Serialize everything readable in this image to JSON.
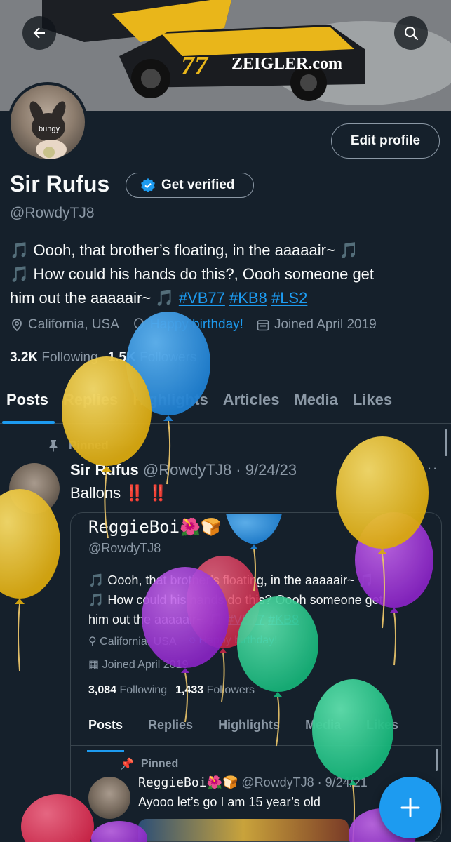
{
  "banner": {
    "car_number": "77",
    "car_text": "ZEIGLER.com"
  },
  "nav": {
    "back_icon": "arrow-left-icon",
    "search_icon": "search-icon"
  },
  "profile": {
    "avatar_text": "bungy",
    "edit_label": "Edit profile",
    "name": "Sir Rufus",
    "verified_label": "Get verified",
    "handle": "@RowdyTJ8",
    "bio_line1": "🎵 Oooh, that brother’s floating, in the aaaaair~ 🎵",
    "bio_line2": "🎵 How could his hands do this?, Oooh someone get",
    "bio_line3": "him out the aaaaair~ 🎵 ",
    "hashtags": [
      "#VB77",
      "#KB8",
      "#LS2"
    ],
    "location": "California, USA",
    "birthday": "Happy birthday!",
    "joined": "Joined April 2019",
    "following_count": "3.2K",
    "following_label": "Following",
    "followers_count": "1.5K",
    "followers_label": "Followers"
  },
  "tabs": [
    "Posts",
    "Replies",
    "Highlights",
    "Articles",
    "Media",
    "Likes"
  ],
  "post": {
    "pinned_label": "Pinned",
    "author": "Sir Rufus",
    "handle_date": "@RowdyTJ8 · 9/24/23",
    "more": "···",
    "text": "Ballons",
    "emphasis": "‼️ ‼️"
  },
  "embed": {
    "name": "ReggieBoi🌺🍞",
    "handle": "@RowdyTJ8",
    "bio_line1": "🎵 Oooh, that brother’s floating, in the aaaaair~ 🎵",
    "bio_line2": "🎵 How could his hands do this? Oooh someone get",
    "bio_line3": "him out the aaaaair~ 🎵 ",
    "hashtags": [
      "#VB77",
      "#KB8"
    ],
    "location": "California, USA",
    "birthday": "Happy birthday!",
    "joined": "Joined April 2019",
    "following_count": "3,084",
    "following_label": "Following",
    "followers_count": "1,433",
    "followers_label": "Followers",
    "tabs": [
      "Posts",
      "Replies",
      "Highlights",
      "Media",
      "Likes"
    ],
    "pinned_label": "Pinned",
    "post_author": "ReggieBoi🌺🍞",
    "post_handle_date": "@RowdyTJ8 · 9/24/21",
    "post_text": "Ayooo let’s go I am 15 year’s old"
  },
  "fab": {
    "icon": "plus-icon"
  },
  "colors": {
    "background": "#15202b",
    "accent": "#1d9bf0",
    "muted": "#8b98a5",
    "balloon_yellow": "#e8b923",
    "balloon_blue": "#2d8fe0",
    "balloon_purple": "#a033d6",
    "balloon_green": "#25c98a",
    "balloon_red": "#e03a5a"
  }
}
